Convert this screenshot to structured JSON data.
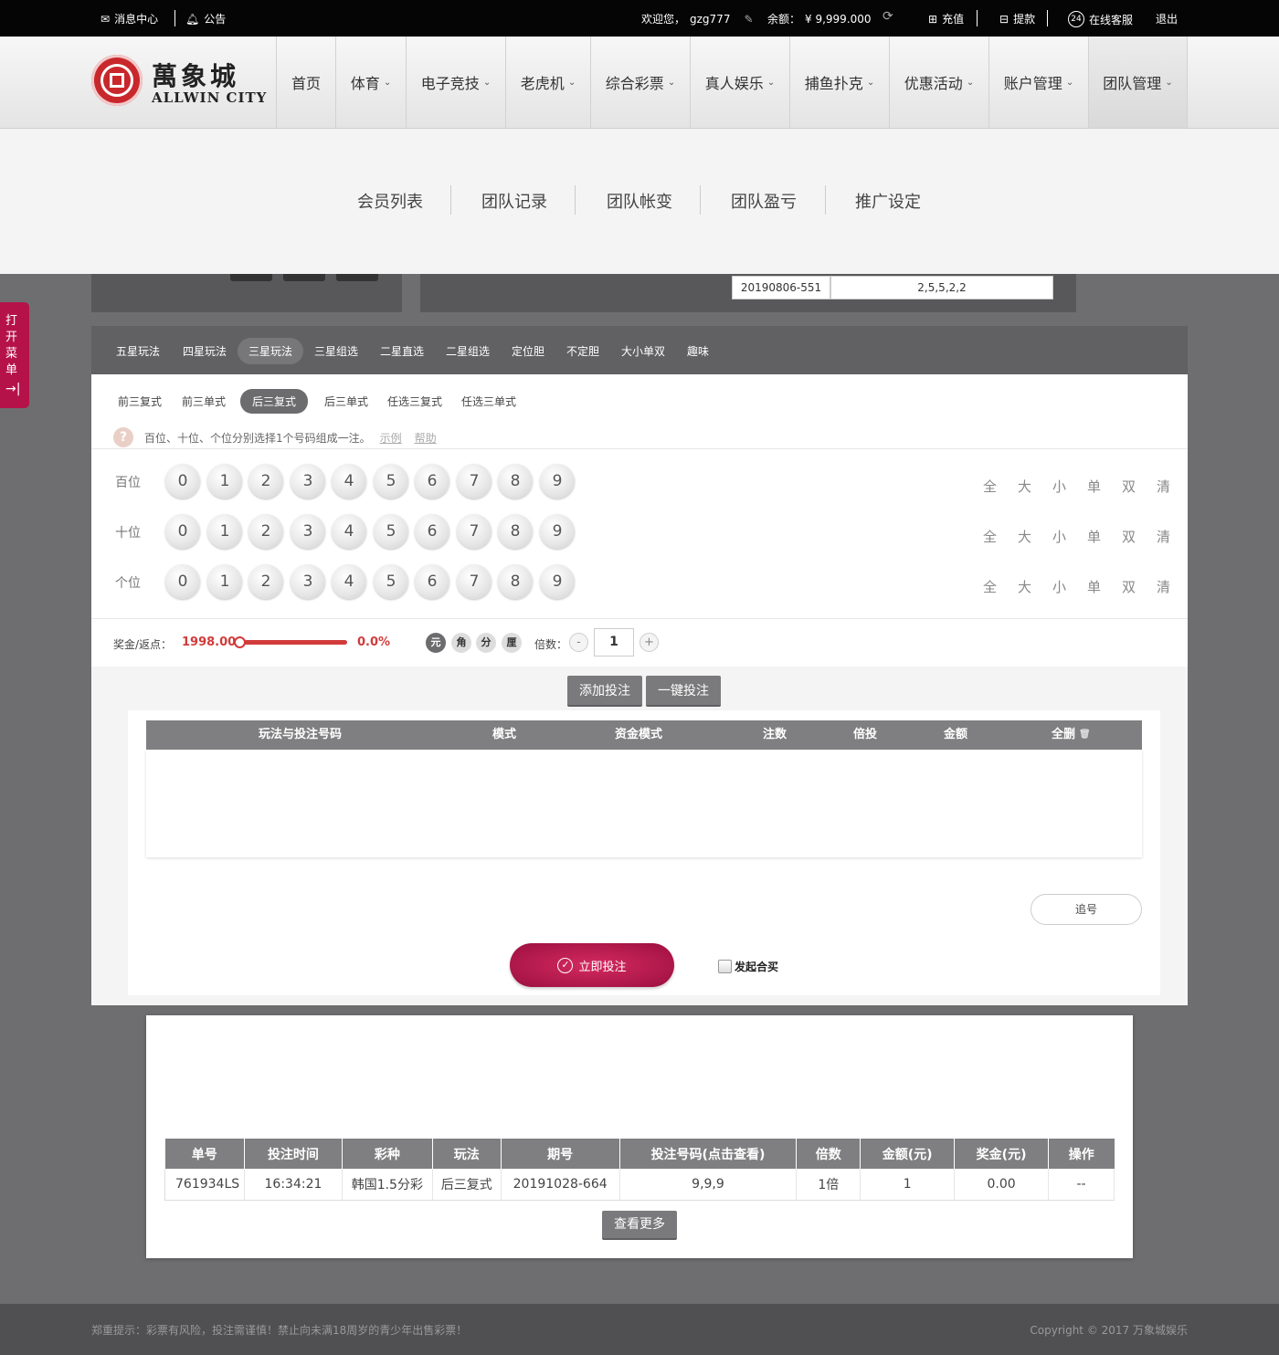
{
  "topbar": {
    "messages": "消息中心",
    "notice": "公告",
    "welcome": "欢迎您，",
    "username": "gzg777",
    "balance_label": "余额：",
    "balance": "¥ 9,999.000",
    "deposit": "充值",
    "withdraw": "提款",
    "service": "在线客服",
    "logout": "退出"
  },
  "logo": {
    "cn": "萬象城",
    "en": "ALLWIN CITY"
  },
  "nav": [
    "首页",
    "体育",
    "电子竞技",
    "老虎机",
    "综合彩票",
    "真人娱乐",
    "捕鱼扑克",
    "优惠活动",
    "账户管理",
    "团队管理"
  ],
  "submenu": [
    "会员列表",
    "团队记录",
    "团队帐变",
    "团队盈亏",
    "推广设定"
  ],
  "draw": {
    "issue": "20190806-551",
    "numbers": "2,5,5,2,2"
  },
  "sidetab": "打开菜单",
  "play_tabs": [
    "五星玩法",
    "四星玩法",
    "三星玩法",
    "三星组选",
    "二星直选",
    "二星组选",
    "定位胆",
    "不定胆",
    "大小单双",
    "趣味"
  ],
  "play_active": "三星玩法",
  "sub_tabs": [
    "前三复式",
    "前三单式",
    "后三复式",
    "后三单式",
    "任选三复式",
    "任选三单式"
  ],
  "sub_active": "后三复式",
  "hint": {
    "text": "百位、十位、个位分别选择1个号码组成一注。",
    "example": "示例",
    "help": "帮助"
  },
  "rows": [
    {
      "label": "百位",
      "digits": [
        "0",
        "1",
        "2",
        "3",
        "4",
        "5",
        "6",
        "7",
        "8",
        "9"
      ]
    },
    {
      "label": "十位",
      "digits": [
        "0",
        "1",
        "2",
        "3",
        "4",
        "5",
        "6",
        "7",
        "8",
        "9"
      ]
    },
    {
      "label": "个位",
      "digits": [
        "0",
        "1",
        "2",
        "3",
        "4",
        "5",
        "6",
        "7",
        "8",
        "9"
      ]
    }
  ],
  "quick": [
    "全",
    "大",
    "小",
    "单",
    "双",
    "清"
  ],
  "bonus": {
    "label": "奖金/返点：",
    "value": "1998.00",
    "rebate": "0.0%",
    "slider_fraction": 0
  },
  "units": [
    "元",
    "角",
    "分",
    "厘"
  ],
  "multiplier": {
    "label": "倍数：",
    "value": "1",
    "minus": "-",
    "plus": "+"
  },
  "buttons": {
    "add": "添加投注",
    "one_click": "一键投注",
    "chase": "追号",
    "bet_now": "立即投注",
    "group_buy": "发起合买",
    "more": "查看更多"
  },
  "bet_table": {
    "headers": [
      "玩法与投注号码",
      "模式",
      "资金模式",
      "注数",
      "倍投",
      "金额",
      "全删"
    ]
  },
  "orders": {
    "headers": [
      "单号",
      "投注时间",
      "彩种",
      "玩法",
      "期号",
      "投注号码(点击查看)",
      "倍数",
      "金额(元)",
      "奖金(元)",
      "操作"
    ],
    "rows": [
      [
        "761934LS",
        "16:34:21",
        "韩国1.5分彩",
        "后三复式",
        "20191028-664",
        "9,9,9",
        "1倍",
        "1",
        "0.00",
        "--"
      ]
    ]
  },
  "footer": {
    "warning": "郑重提示：彩票有风险，投注需谨慎！禁止向未满18周岁的青少年出售彩票！",
    "copyright": "Copyright © 2017 万象城娱乐"
  },
  "colors": {
    "accent": "#b5124a",
    "dark": "#050505",
    "gray": "#7f7f81"
  }
}
